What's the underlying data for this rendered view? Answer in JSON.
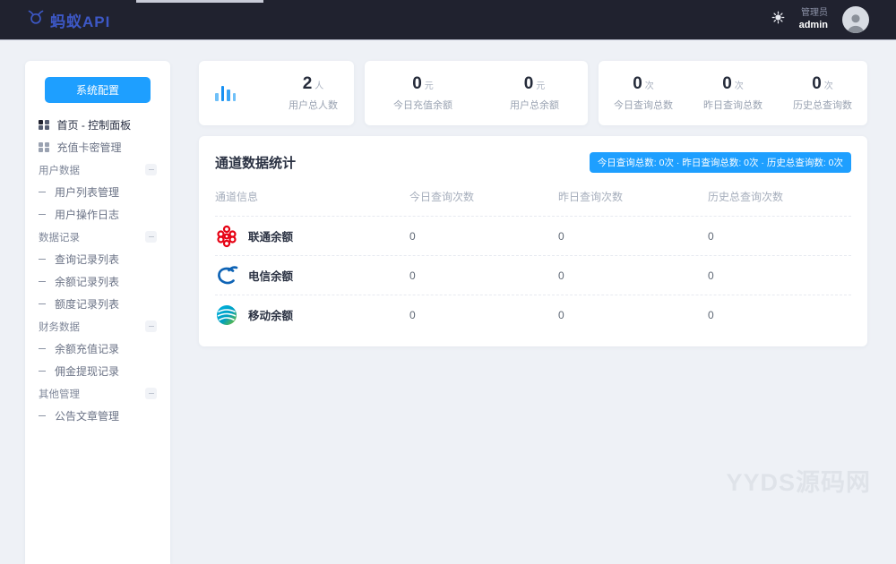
{
  "header": {
    "logo_text": "蚂蚁API",
    "user_role": "管理员",
    "user_name": "admin"
  },
  "sidebar": {
    "config_button": "系统配置",
    "items": [
      {
        "label": "首页 - 控制面板",
        "type": "icon",
        "active": true
      },
      {
        "label": "充值卡密管理",
        "type": "icon",
        "active": false
      },
      {
        "label": "用户数据",
        "type": "group"
      },
      {
        "label": "用户列表管理",
        "type": "child"
      },
      {
        "label": "用户操作日志",
        "type": "child"
      },
      {
        "label": "数据记录",
        "type": "group"
      },
      {
        "label": "查询记录列表",
        "type": "child"
      },
      {
        "label": "余额记录列表",
        "type": "child"
      },
      {
        "label": "额度记录列表",
        "type": "child"
      },
      {
        "label": "财务数据",
        "type": "group"
      },
      {
        "label": "余额充值记录",
        "type": "child"
      },
      {
        "label": "佣金提现记录",
        "type": "child"
      },
      {
        "label": "其他管理",
        "type": "group"
      },
      {
        "label": "公告文章管理",
        "type": "child"
      }
    ]
  },
  "stats": [
    {
      "value": "2",
      "unit": "人",
      "label": "用户总人数"
    },
    {
      "value": "0",
      "unit": "元",
      "label": "今日充值余额"
    },
    {
      "value": "0",
      "unit": "元",
      "label": "用户总余额"
    },
    {
      "value": "0",
      "unit": "次",
      "label": "今日查询总数"
    },
    {
      "value": "0",
      "unit": "次",
      "label": "昨日查询总数"
    },
    {
      "value": "0",
      "unit": "次",
      "label": "历史总查询数"
    }
  ],
  "panel": {
    "title": "通道数据统计",
    "badge": "今日查询总数: 0次 · 昨日查询总数: 0次 · 历史总查询数: 0次",
    "table": {
      "headers": [
        "通道信息",
        "今日查询次数",
        "昨日查询次数",
        "历史总查询次数"
      ],
      "rows": [
        {
          "name": "联通余额",
          "logo": "unicom-logo",
          "today": "0",
          "yesterday": "0",
          "total": "0"
        },
        {
          "name": "电信余额",
          "logo": "telecom-logo",
          "today": "0",
          "yesterday": "0",
          "total": "0"
        },
        {
          "name": "移动余额",
          "logo": "mobile-logo",
          "today": "0",
          "yesterday": "0",
          "total": "0"
        }
      ]
    }
  },
  "watermark": "YYDS源码网",
  "colors": {
    "accent": "#1e9fff",
    "header_bg": "#20222f",
    "logo_blue": "#3d58c6",
    "unicom_red": "#e60012",
    "telecom_blue": "#0e63b5",
    "mobile_blue": "#00b3e3",
    "mobile_green": "#7fc31c"
  }
}
